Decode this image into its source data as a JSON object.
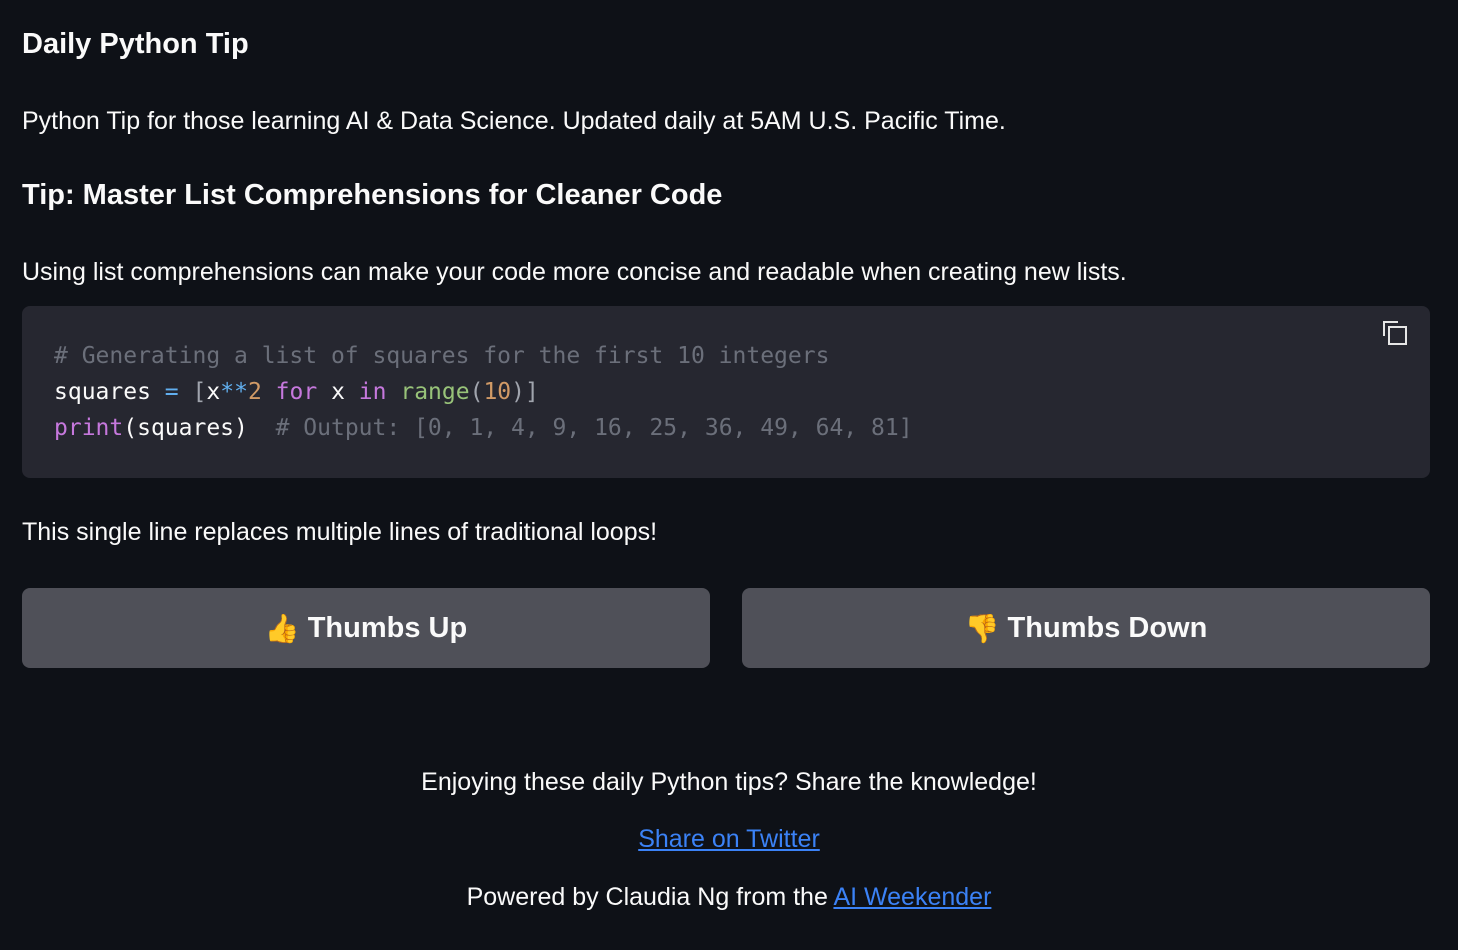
{
  "app": {
    "title": "Daily Python Tip",
    "intro": "Python Tip for those learning AI & Data Science. Updated daily at 5AM U.S. Pacific Time."
  },
  "tip": {
    "title": "Tip: Master List Comprehensions for Cleaner Code",
    "description": "Using list comprehensions can make your code more concise and readable when creating new lists.",
    "code": {
      "line1_comment": "# Generating a list of squares for the first 10 integers",
      "line2": {
        "var": "squares",
        "assign": "=",
        "open_bracket": "[",
        "x1": "x",
        "pow_op": "**",
        "two": "2",
        "for_kw": "for",
        "x2": "x",
        "in_kw": "in",
        "range_fn": "range",
        "open_paren": "(",
        "ten": "10",
        "close": ")]"
      },
      "line3": {
        "print_fn": "print",
        "args": "(squares)",
        "comment": "# Output: [0, 1, 4, 9, 16, 25, 36, 49, 64, 81]"
      },
      "copy_icon": "copy-icon"
    },
    "closing": "This single line replaces multiple lines of traditional loops!"
  },
  "feedback": {
    "up_emoji": "👍",
    "up_label": "Thumbs Up",
    "down_emoji": "👎",
    "down_label": "Thumbs Down"
  },
  "footer": {
    "share_prompt": "Enjoying these daily Python tips? Share the knowledge!",
    "twitter_link": "Share on Twitter",
    "powered_by": "Powered by Claudia Ng from the ",
    "weekender_link": "AI Weekender"
  },
  "colors": {
    "background": "#0e1117",
    "code_bg": "#262730",
    "button_bg": "#4f5058",
    "link": "#3b82f6"
  }
}
